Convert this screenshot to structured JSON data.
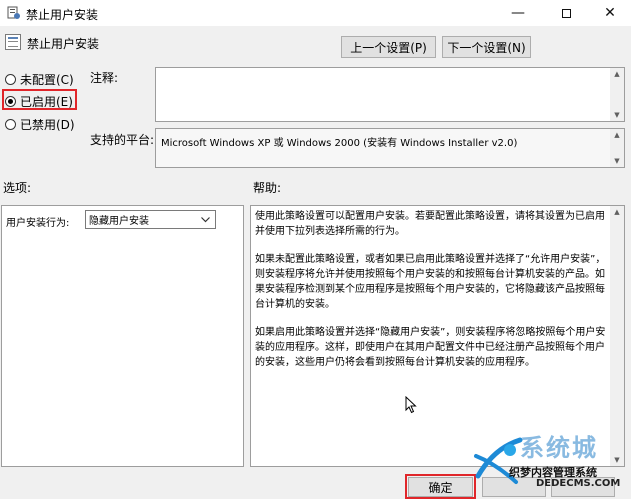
{
  "window": {
    "title": "禁止用户安装"
  },
  "header": {
    "policy_name": "禁止用户安装",
    "prev_button": "上一个设置(P)",
    "next_button": "下一个设置(N)"
  },
  "state": {
    "options": [
      {
        "label": "未配置(C)",
        "checked": false
      },
      {
        "label": "已启用(E)",
        "checked": true
      },
      {
        "label": "已禁用(D)",
        "checked": false
      }
    ]
  },
  "comment": {
    "label": "注释:",
    "value": ""
  },
  "supported": {
    "label": "支持的平台:",
    "value": "Microsoft Windows XP 或 Windows 2000 (安装有 Windows Installer v2.0)"
  },
  "options_panel": {
    "label": "选项:",
    "field_label": "用户安装行为:",
    "selected": "隐藏用户安装"
  },
  "help": {
    "label": "帮助:",
    "paragraphs": [
      "使用此策略设置可以配置用户安装。若要配置此策略设置，请将其设置为已启用并使用下拉列表选择所需的行为。",
      "如果未配置此策略设置，或者如果已启用此策略设置并选择了“允许用户安装”，则安装程序将允许并使用按照每个用户安装的和按照每台计算机安装的产品。如果安装程序检测到某个应用程序是按照每个用户安装的，它将隐藏该产品按照每台计算机的安装。",
      "如果启用此策略设置并选择“隐藏用户安装”，则安装程序将忽略按照每个用户安装的应用程序。这样，即使用户在其用户配置文件中已经注册产品按照每个用户的安装，这些用户仍将会看到按照每台计算机安装的应用程序。"
    ]
  },
  "footer": {
    "ok_button": "确定"
  },
  "watermark": {
    "line1": "织梦内容管理系统",
    "line2": "DEDECMS.COM",
    "brand": "系统城"
  },
  "colors": {
    "highlight_border": "#e0262a",
    "background": "#f0f0f0"
  }
}
